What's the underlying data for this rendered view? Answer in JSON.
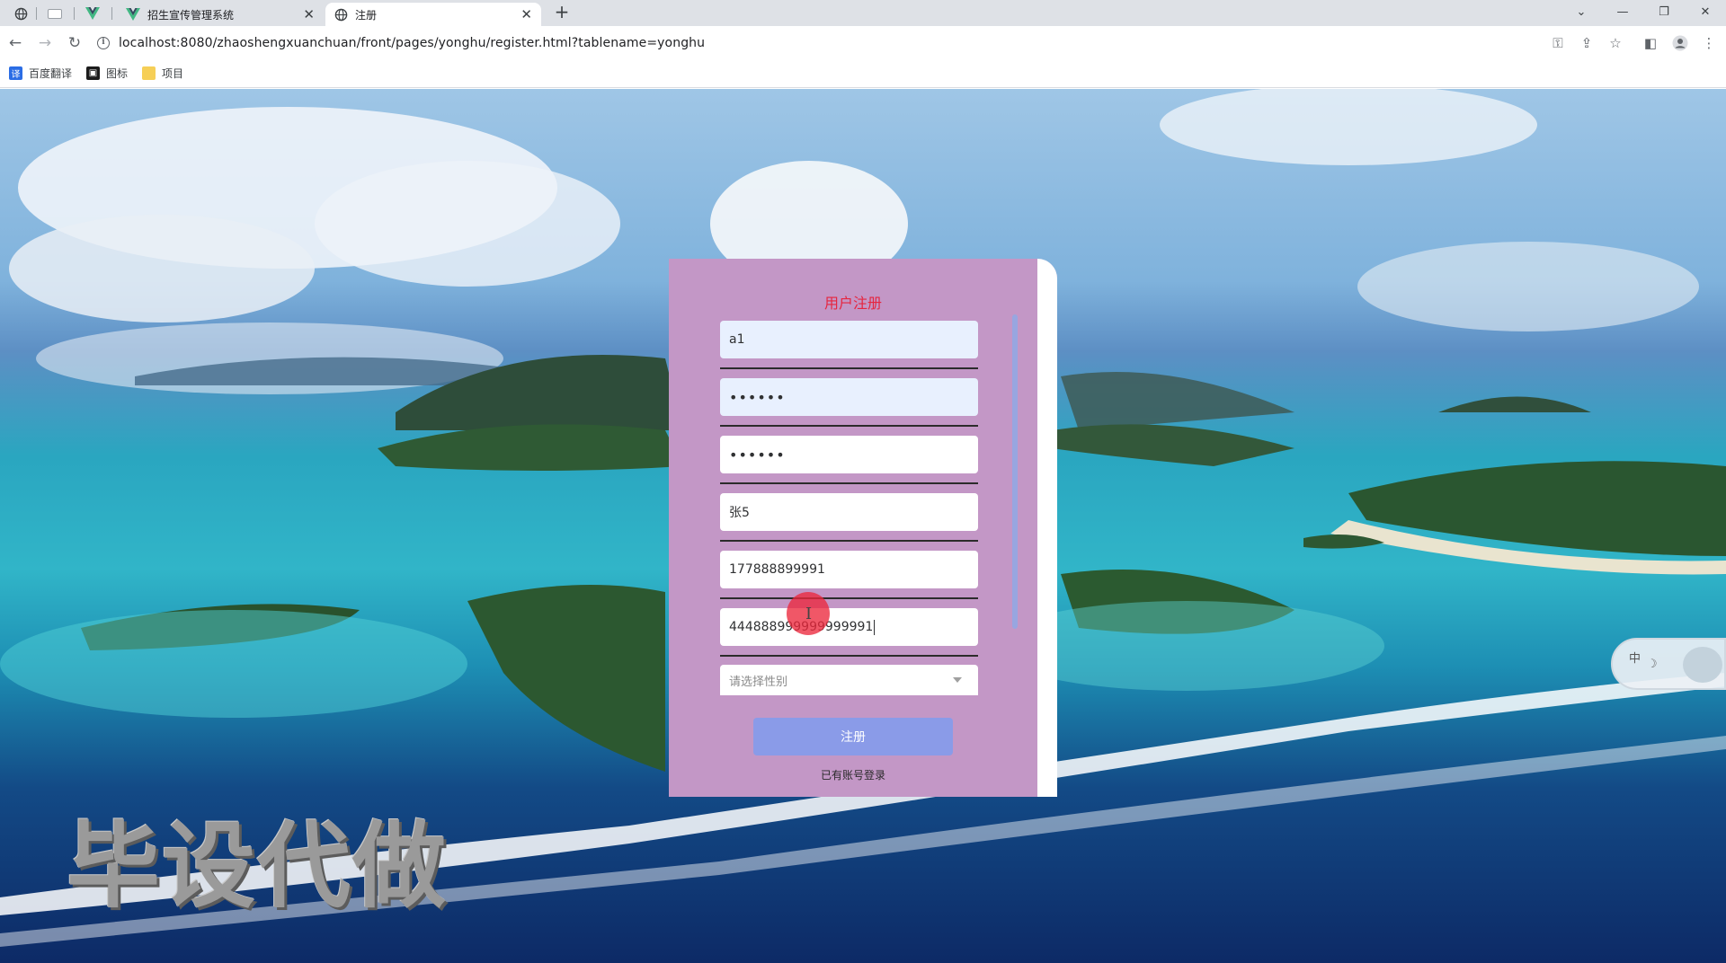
{
  "browser": {
    "tabs": [
      {
        "title": "招生宣传管理系统",
        "active": false
      },
      {
        "title": "注册",
        "active": true
      }
    ],
    "url": "localhost:8080/zhaoshengxuanchuan/front/pages/yonghu/register.html?tablename=yonghu",
    "bookmarks": [
      {
        "label": "百度翻译",
        "icon": "baidu-translate-icon"
      },
      {
        "label": "图标",
        "icon": "image-icon"
      },
      {
        "label": "项目",
        "icon": "folder-icon"
      }
    ]
  },
  "form": {
    "title": "用户注册",
    "fields": [
      {
        "value": "a1",
        "type": "text"
      },
      {
        "value": "••••••",
        "type": "password"
      },
      {
        "value": "••••••",
        "type": "password"
      },
      {
        "value": "张5",
        "type": "text"
      },
      {
        "value": "177888899991",
        "type": "text"
      },
      {
        "value": "444888999999999991",
        "type": "text"
      }
    ],
    "gender_placeholder": "请选择性别",
    "submit_label": "注册",
    "login_link": "已有账号登录"
  },
  "overlay": {
    "watermark": "毕设代做",
    "ime_mode": "中"
  },
  "colors": {
    "panel": "#c397c6",
    "title": "#e6253f",
    "button": "#8a9be8",
    "click_indicator": "#ec283c"
  }
}
